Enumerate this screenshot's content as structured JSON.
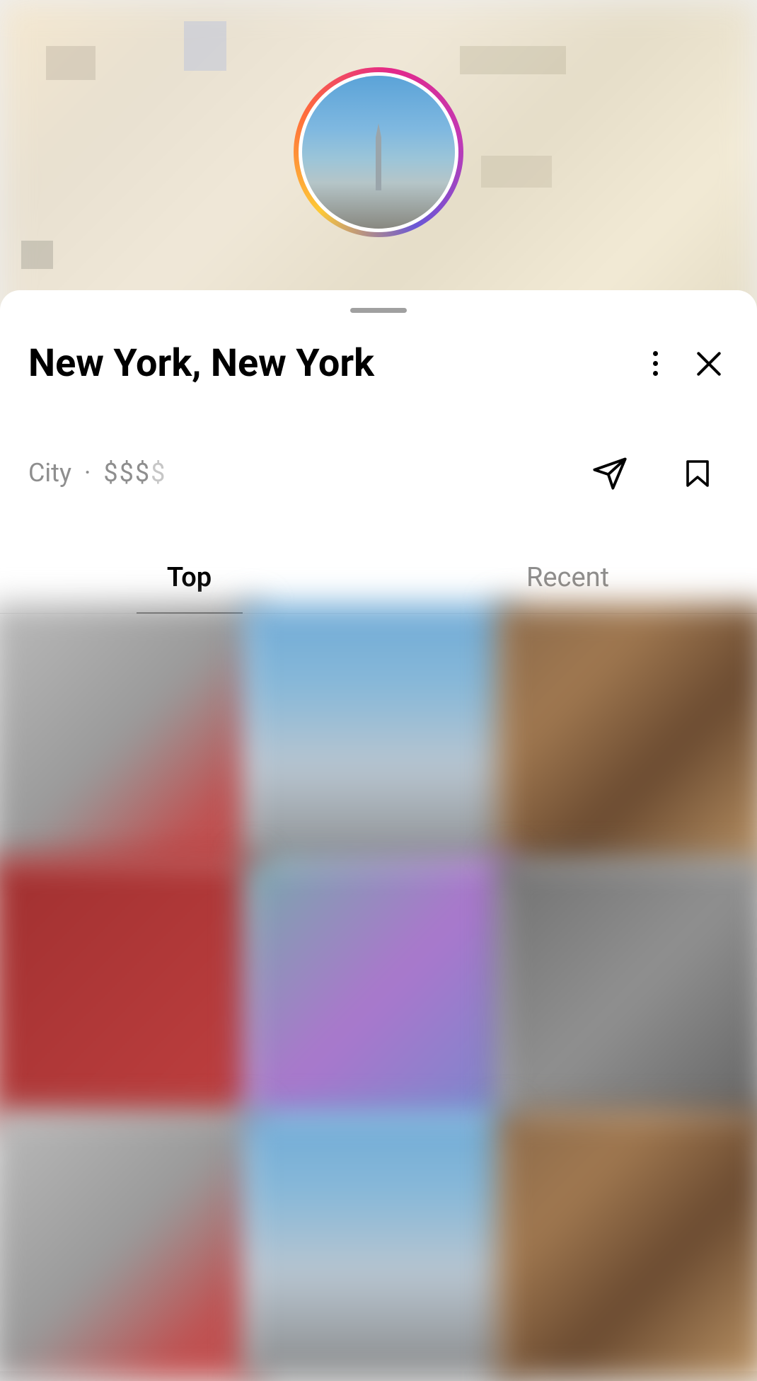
{
  "location": {
    "title": "New York, New York",
    "category": "City",
    "separator": "·",
    "price_level_full": "$$$",
    "price_level_dim": "$"
  },
  "tabs": {
    "top": "Top",
    "recent": "Recent"
  },
  "icons": {
    "more": "more-vertical",
    "close": "close",
    "share": "send",
    "bookmark": "bookmark"
  }
}
